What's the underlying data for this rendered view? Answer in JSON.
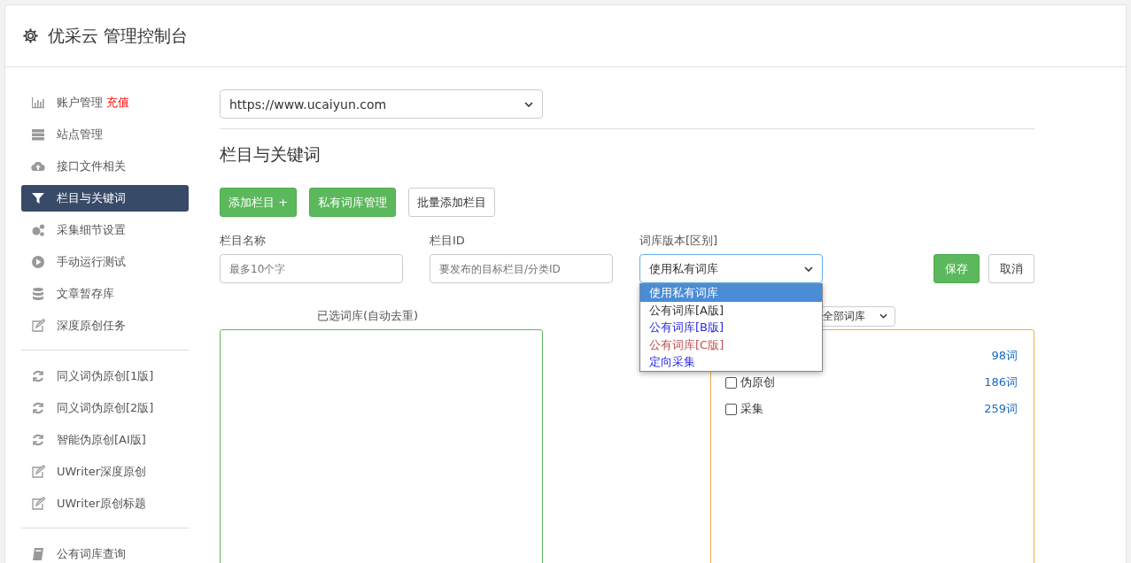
{
  "header": {
    "title": "优采云 管理控制台"
  },
  "sidebar": {
    "groups": [
      {
        "items": [
          {
            "label": "账户管理",
            "badge": "充值",
            "selected": false
          },
          {
            "label": "站点管理",
            "selected": false
          },
          {
            "label": "接口文件相关",
            "selected": false
          },
          {
            "label": "栏目与关键词",
            "selected": true
          },
          {
            "label": "采集细节设置",
            "selected": false
          },
          {
            "label": "手动运行测试",
            "selected": false
          },
          {
            "label": "文章暂存库",
            "selected": false
          },
          {
            "label": "深度原创任务",
            "selected": false
          }
        ]
      },
      {
        "items": [
          {
            "label": "同义词伪原创[1版]",
            "selected": false
          },
          {
            "label": "同义词伪原创[2版]",
            "selected": false
          },
          {
            "label": "智能伪原创[AI版]",
            "selected": false
          },
          {
            "label": "UWriter深度原创",
            "selected": false
          },
          {
            "label": "UWriter原创标题",
            "selected": false
          }
        ]
      },
      {
        "items": [
          {
            "label": "公有词库查询",
            "selected": false
          }
        ]
      }
    ]
  },
  "site_select": {
    "value": "https://www.ucaiyun.com"
  },
  "section_title": "栏目与关键词",
  "actions": [
    {
      "label": "添加栏目 +",
      "kind": "primary"
    },
    {
      "label": "私有词库管理",
      "kind": "primary"
    },
    {
      "label": "批量添加栏目",
      "kind": "default"
    }
  ],
  "form": {
    "name": {
      "label": "栏目名称",
      "placeholder": "最多10个字"
    },
    "id": {
      "label": "栏目ID",
      "placeholder": "要发布的目标栏目/分类ID"
    },
    "version": {
      "label": "词库版本[区别]",
      "value": "使用私有词库",
      "expanded": true,
      "options": [
        {
          "label": "使用私有词库",
          "selected": true
        },
        {
          "label": "公有词库[A版]",
          "selected": false,
          "color": "#333333"
        },
        {
          "label": "公有词库[B版]",
          "selected": false,
          "color": "#2a2ae0"
        },
        {
          "label": "公有词库[C版]",
          "selected": false,
          "color": "#c0504d"
        },
        {
          "label": "定向采集",
          "selected": false,
          "color": "#2a2ae0"
        }
      ]
    },
    "save": "保存",
    "cancel": "取消"
  },
  "selected_label": "已选词库(自动去重)",
  "library_filter": {
    "value": "全部词库"
  },
  "libraries": [
    {
      "count": "98词"
    },
    {
      "label": "伪原创",
      "count": "186词",
      "checked": false
    },
    {
      "label": "采集",
      "count": "259词",
      "checked": false
    }
  ]
}
